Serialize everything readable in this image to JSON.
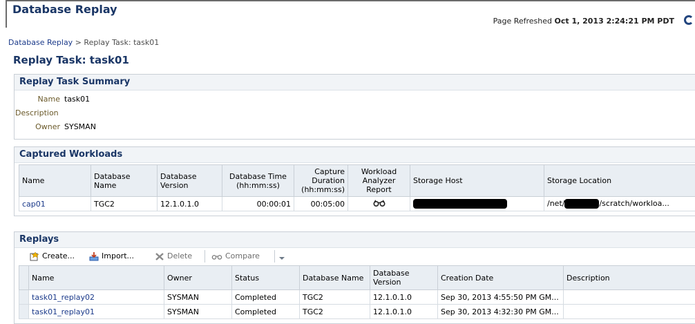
{
  "header": {
    "title": "Database Replay",
    "refresh_label": "Page Refreshed",
    "refresh_time": "Oct 1, 2013 2:24:21 PM PDT"
  },
  "breadcrumb": {
    "root": "Database Replay",
    "separator": " > ",
    "current": "Replay Task: task01"
  },
  "task_title": "Replay Task: task01",
  "summary": {
    "heading": "Replay Task Summary",
    "fields": [
      {
        "label": "Name",
        "value": "task01"
      },
      {
        "label": "Description",
        "value": ""
      },
      {
        "label": "Owner",
        "value": "SYSMAN"
      }
    ]
  },
  "captured": {
    "heading": "Captured Workloads",
    "columns": [
      "Name",
      "Database Name",
      "Database Version",
      "Database Time (hh:mm:ss)",
      "Capture Duration (hh:mm:ss)",
      "Workload Analyzer Report",
      "Storage Host",
      "Storage Location"
    ],
    "row": {
      "name": "cap01",
      "db_name": "TGC2",
      "db_version": "12.1.0.1.0",
      "db_time": "00:00:01",
      "duration": "00:05:00",
      "report_icon": "glasses-icon",
      "location_prefix": "/net/",
      "location_suffix": "/scratch/workloa..."
    }
  },
  "replays": {
    "heading": "Replays",
    "toolbar": {
      "create": "Create...",
      "import": "Import...",
      "delete": "Delete",
      "compare": "Compare"
    },
    "columns": [
      "Name",
      "Owner",
      "Status",
      "Database Name",
      "Database Version",
      "Creation Date",
      "Description"
    ],
    "rows": [
      {
        "name": "task01_replay02",
        "owner": "SYSMAN",
        "status": "Completed",
        "db_name": "TGC2",
        "db_version": "12.1.0.1.0",
        "created": "Sep 30, 2013 4:55:50 PM GM...",
        "description": ""
      },
      {
        "name": "task01_replay01",
        "owner": "SYSMAN",
        "status": "Completed",
        "db_name": "TGC2",
        "db_version": "12.1.0.1.0",
        "created": "Sep 30, 2013 4:32:30 PM GM...",
        "description": ""
      }
    ]
  },
  "colors": {
    "title": "#1a3666",
    "link": "#1b3a8a",
    "header_bg": "#e9eef3"
  }
}
